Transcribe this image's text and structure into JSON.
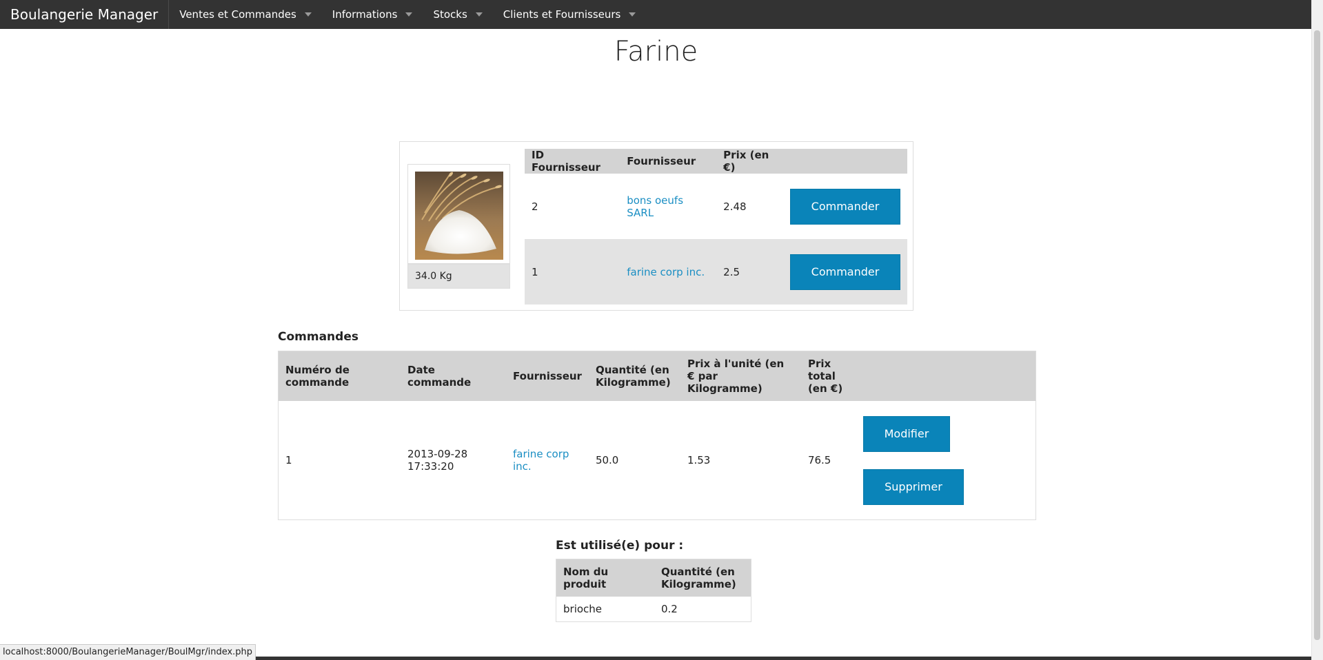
{
  "navbar": {
    "brand": "Boulangerie Manager",
    "menus": [
      {
        "label": "Ventes et Commandes"
      },
      {
        "label": "Informations"
      },
      {
        "label": "Stocks"
      },
      {
        "label": "Clients et Fournisseurs"
      }
    ]
  },
  "page": {
    "title": "Farine"
  },
  "product": {
    "stock": "34.0 Kg",
    "image_alt": "Farine"
  },
  "suppliers": {
    "headers": [
      "ID Fournisseur",
      "Fournisseur",
      "Prix (en €)"
    ],
    "rows": [
      {
        "id": "2",
        "name": "bons oeufs SARL",
        "price": "2.48",
        "action": "Commander"
      },
      {
        "id": "1",
        "name": "farine corp inc.",
        "price": "2.5",
        "action": "Commander"
      }
    ]
  },
  "orders": {
    "section_title": "Commandes",
    "headers": {
      "number": "Numéro de commande",
      "date": "Date commande",
      "supplier": "Fournisseur",
      "quantity": "Quantité (en Kilogramme)",
      "unit_price": "Prix à l'unité (en € par Kilogramme)",
      "total": "Prix total (en €)"
    },
    "rows": [
      {
        "number": "1",
        "date": "2013-09-28 17:33:20",
        "supplier": "farine corp inc.",
        "quantity": "50.0",
        "unit_price": "1.53",
        "total": "76.5",
        "edit": "Modifier",
        "delete": "Supprimer"
      }
    ]
  },
  "usage": {
    "section_title": "Est utilisé(e) pour :",
    "headers": {
      "product": "Nom du produit",
      "quantity": "Quantité (en Kilogramme)"
    },
    "rows": [
      {
        "product": "brioche",
        "quantity": "0.2"
      }
    ]
  },
  "status_bar": {
    "url": "localhost:8000/BoulangerieManager/BoulMgr/index.php"
  },
  "colors": {
    "navbar": "#333333",
    "button": "#0a84b9",
    "link": "#1a8ec3",
    "table_header": "#d3d3d3",
    "row_alt": "#e3e3e3"
  }
}
